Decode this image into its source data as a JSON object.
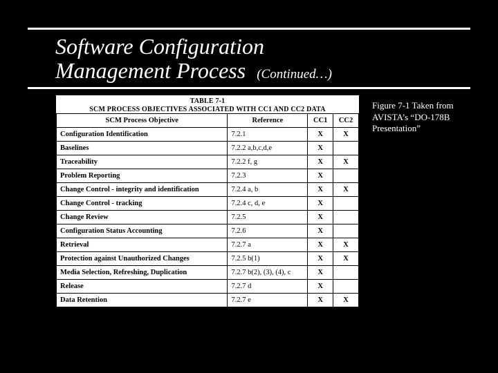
{
  "title": {
    "line1": "Software Configuration",
    "line2": "Management Process",
    "continued": "(Continued…)"
  },
  "table": {
    "caption_line1": "TABLE 7-1",
    "caption_line2": "SCM PROCESS OBJECTIVES ASSOCIATED WITH CC1 AND CC2 DATA",
    "headers": {
      "objective": "SCM Process Objective",
      "reference": "Reference",
      "cc1": "CC1",
      "cc2": "CC2"
    },
    "rows": [
      {
        "objective": "Configuration Identification",
        "reference": "7.2.1",
        "cc1": "X",
        "cc2": "X"
      },
      {
        "objective": "Baselines",
        "reference": "7.2.2 a,b,c,d,e",
        "cc1": "X",
        "cc2": ""
      },
      {
        "objective": "Traceability",
        "reference": "7.2.2 f, g",
        "cc1": "X",
        "cc2": "X"
      },
      {
        "objective": "Problem Reporting",
        "reference": "7.2.3",
        "cc1": "X",
        "cc2": ""
      },
      {
        "objective": "Change Control - integrity and identification",
        "reference": "7.2.4 a, b",
        "cc1": "X",
        "cc2": "X"
      },
      {
        "objective": "Change Control - tracking",
        "reference": "7.2.4 c, d, e",
        "cc1": "X",
        "cc2": ""
      },
      {
        "objective": "Change Review",
        "reference": "7.2.5",
        "cc1": "X",
        "cc2": ""
      },
      {
        "objective": "Configuration Status Accounting",
        "reference": "7.2.6",
        "cc1": "X",
        "cc2": ""
      },
      {
        "objective": "Retrieval",
        "reference": "7.2.7 a",
        "cc1": "X",
        "cc2": "X"
      },
      {
        "objective": "Protection against Unauthorized Changes",
        "reference": "7.2.5 b(1)",
        "cc1": "X",
        "cc2": "X"
      },
      {
        "objective": "Media Selection, Refreshing, Duplication",
        "reference": "7.2.7 b(2), (3), (4), c",
        "cc1": "X",
        "cc2": ""
      },
      {
        "objective": "Release",
        "reference": "7.2.7 d",
        "cc1": "X",
        "cc2": ""
      },
      {
        "objective": "Data Retention",
        "reference": "7.2.7 e",
        "cc1": "X",
        "cc2": "X"
      }
    ]
  },
  "caption": {
    "line1": "Figure 7-1 Taken from",
    "line2": "AVISTA’s “DO-178B",
    "line3": "Presentation”"
  }
}
